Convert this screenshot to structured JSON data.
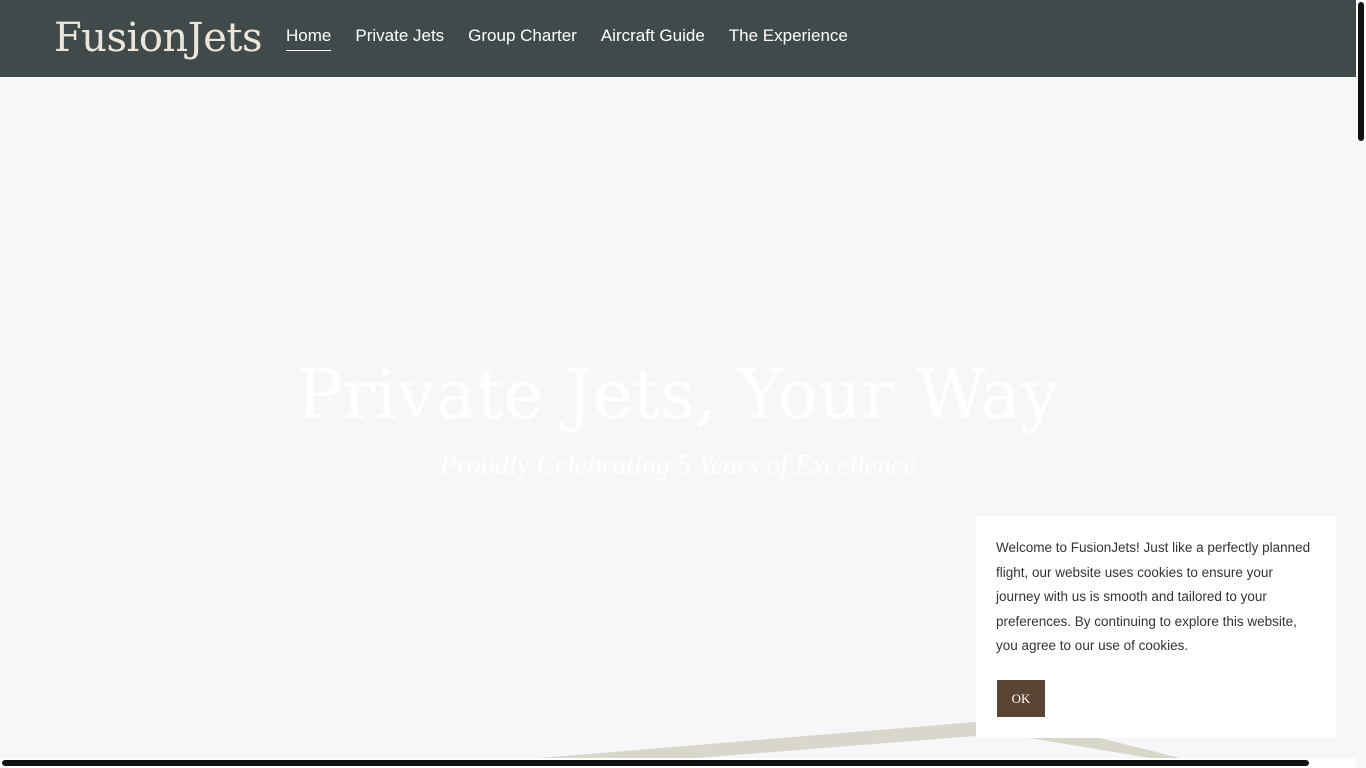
{
  "header": {
    "logo": "FusionJets",
    "nav": [
      {
        "label": "Home",
        "active": true
      },
      {
        "label": "Private Jets",
        "active": false
      },
      {
        "label": "Group Charter",
        "active": false
      },
      {
        "label": "Aircraft Guide",
        "active": false
      },
      {
        "label": "The Experience",
        "active": false
      }
    ]
  },
  "hero": {
    "title": "Private Jets, Your Way",
    "subtitle": "Proudly Celebrating 5 Years of Excellence"
  },
  "cookie_banner": {
    "text": "Welcome to FusionJets! Just like a perfectly planned flight, our website uses cookies to ensure your journey with us is smooth and tailored to your preferences. By continuing to explore this website, you agree to our use of cookies.",
    "ok_label": "OK"
  },
  "colors": {
    "header_bg": "#414a4a",
    "page_bg": "#f6f7f9",
    "logo": "#ece6da",
    "ok_button": "#5a4535",
    "wing": "#d9d6cc"
  }
}
